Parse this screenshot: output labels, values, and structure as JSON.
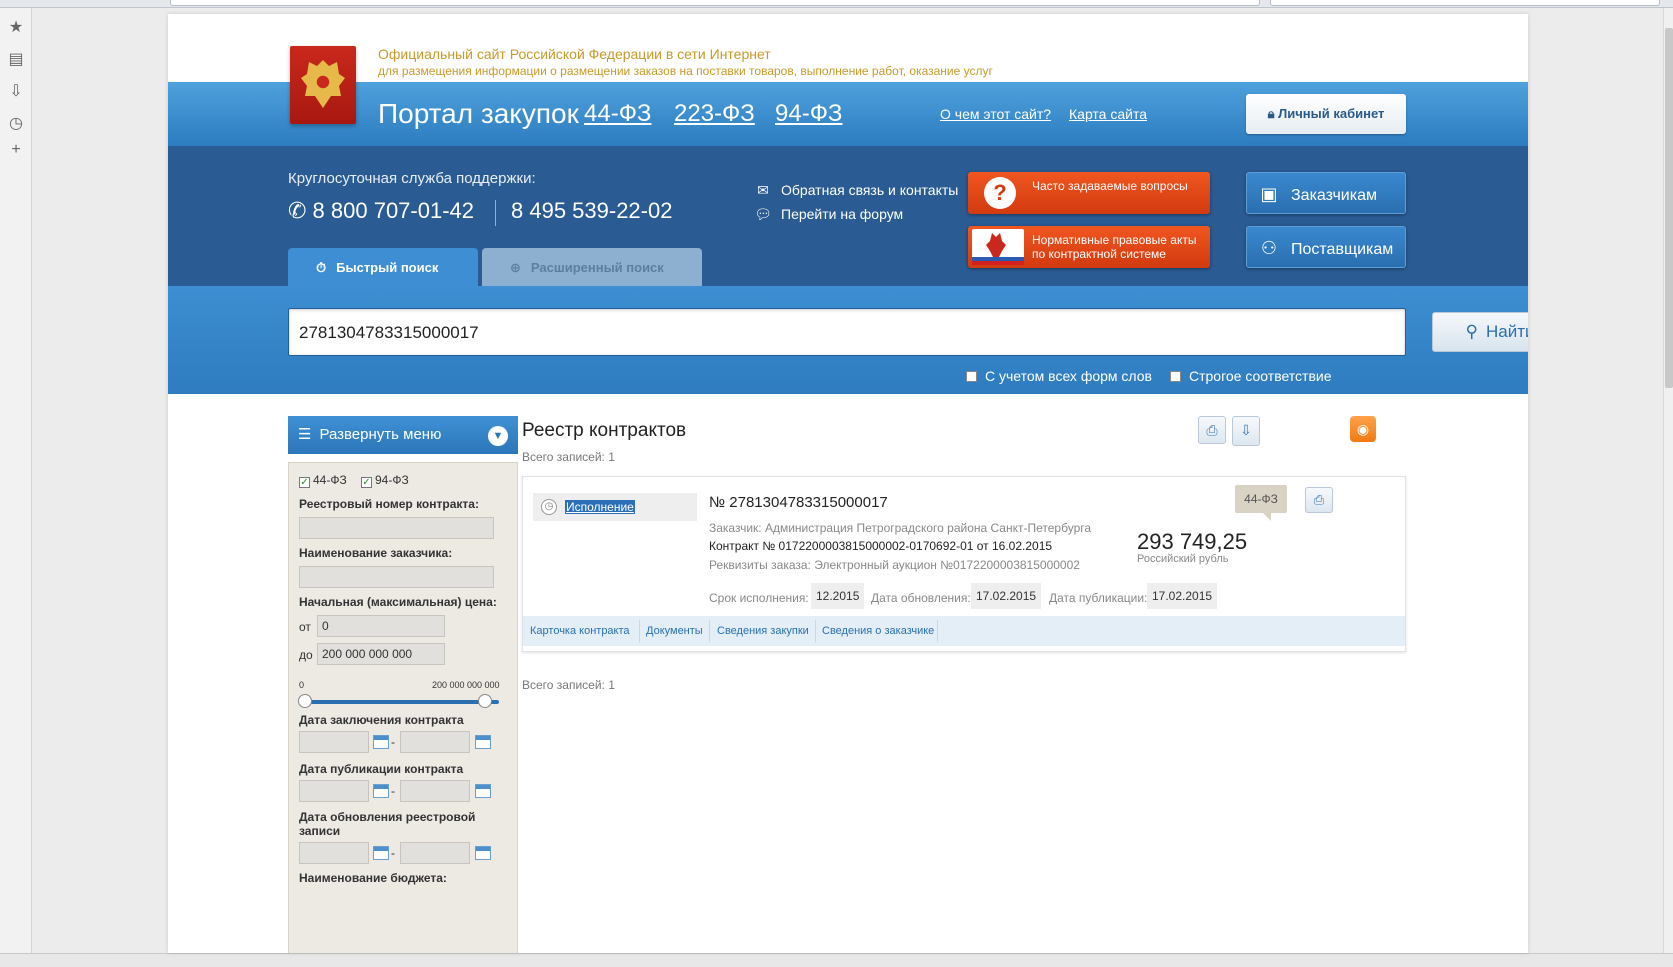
{
  "site": {
    "subtitle1": "Официальный сайт Российской Федерации в сети Интернет",
    "subtitle2": "для размещения информации о размещении заказов на поставки товаров, выполнение работ, оказание услуг",
    "portal_title": "Портал закупок",
    "laws": [
      "44-ФЗ",
      "223-ФЗ",
      "94-ФЗ"
    ],
    "about_link": "О чем этот сайт?",
    "sitemap_link": "Карта сайта",
    "cabinet_label": "Личный кабинет"
  },
  "support": {
    "label": "Круглосуточная служба поддержки:",
    "phone1": "8 800 707-01-42",
    "phone2": "8 495 539-22-02",
    "feedback_link": "Обратная связь и контакты",
    "forum_link": "Перейти на форум"
  },
  "buttons": {
    "faq": "Часто задаваемые вопросы",
    "legal": "Нормативные правовые акты по контрактной системе",
    "customers": "Заказчикам",
    "suppliers": "Поставщикам"
  },
  "search": {
    "tab_quick": "Быстрый поиск",
    "tab_advanced": "Расширенный поиск",
    "query": "2781304783315000017",
    "find_label": "Найти",
    "opt_word_forms": "С учетом всех форм слов",
    "opt_strict": "Строгое соответствие"
  },
  "filter": {
    "menu_label": "Развернуть меню",
    "law_44": "44-ФЗ",
    "law_94": "94-ФЗ",
    "reg_number_label": "Реестровый номер контракта:",
    "customer_name_label": "Наименование заказчика:",
    "price_label": "Начальная (максимальная) цена:",
    "from_label": "от",
    "from_value": "0",
    "to_label": "до",
    "to_value": "200 000 000 000",
    "slider_min": "0",
    "slider_max": "200 000 000 000",
    "date_conclusion_label": "Дата заключения контракта",
    "date_publication_label": "Дата публикации контракта",
    "date_update_label": "Дата обновления реестровой записи",
    "budget_label": "Наименование бюджета:",
    "dash": "-"
  },
  "registry": {
    "title": "Реестр контрактов",
    "total": "Всего записей: 1",
    "total_bottom": "Всего записей: 1"
  },
  "contract": {
    "status": "Исполнение",
    "number": "№ 2781304783315000017",
    "customer": "Заказчик: Администрация Петроградского района Санкт-Петербурга",
    "contract_line": "Контракт № 0172200003815000002-0170692-01 от 16.02.2015",
    "order_req": "Реквизиты заказа: Электронный аукцион №0172200003815000002",
    "price": "293 749,25",
    "currency": "Российский рубль",
    "law": "44-ФЗ",
    "exec_label": "Срок исполнения:",
    "exec_value": "12.2015",
    "update_label": "Дата обновления:",
    "update_value": "17.02.2015",
    "pub_label": "Дата публикации:",
    "pub_value": "17.02.2015",
    "tabs": [
      "Карточка контракта",
      "Документы",
      "Сведения закупки",
      "Сведения о заказчике"
    ]
  },
  "colors": {
    "header_blue": "#3a8fd4",
    "header_dark": "#2a5b92",
    "accent_red": "#e04a16",
    "gold": "#c69a2a"
  }
}
